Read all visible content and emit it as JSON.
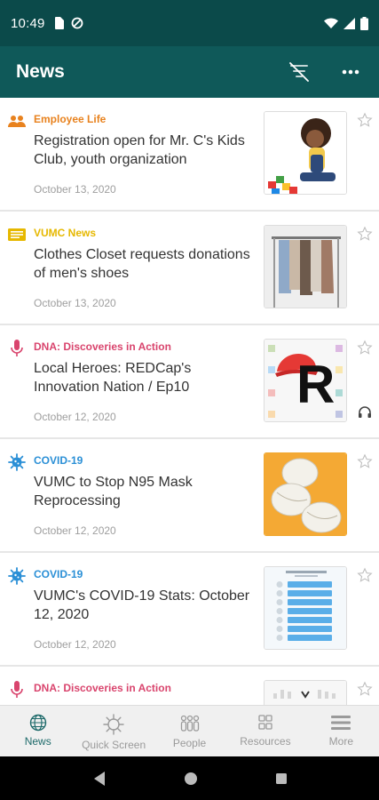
{
  "status_bar": {
    "time": "10:49"
  },
  "app_bar": {
    "title": "News"
  },
  "articles": [
    {
      "category": "Employee Life",
      "category_color": "#e8821e",
      "category_icon": "people-icon",
      "title": "Registration open for Mr. C's Kids Club, youth organization",
      "date": "October 13, 2020",
      "thumbnail": "child-playing-thumbnail"
    },
    {
      "category": "VUMC News",
      "category_color": "#e6b800",
      "category_icon": "newspaper-icon",
      "title": "Clothes Closet requests donations of men's shoes",
      "date": "October 13, 2020",
      "thumbnail": "clothes-rack-thumbnail"
    },
    {
      "category": "DNA: Discoveries in Action",
      "category_color": "#d9446d",
      "category_icon": "microphone-icon",
      "title": "Local Heroes: REDCap's Innovation Nation / Ep10",
      "date": "October 12, 2020",
      "thumbnail": "redcap-logo-thumbnail",
      "audio": true,
      "logo_letter": "R"
    },
    {
      "category": "COVID-19",
      "category_color": "#2a8fd6",
      "category_icon": "virus-icon",
      "title": "VUMC to Stop N95 Mask Reprocessing",
      "date": "October 12, 2020",
      "thumbnail": "n95-masks-thumbnail"
    },
    {
      "category": "COVID-19",
      "category_color": "#2a8fd6",
      "category_icon": "virus-icon",
      "title": "VUMC's COVID-19 Stats: October 12, 2020",
      "date": "October 12, 2020",
      "thumbnail": "stats-infographic-thumbnail"
    },
    {
      "category": "DNA: Discoveries in Action",
      "category_color": "#d9446d",
      "category_icon": "microphone-icon",
      "title": "",
      "date": "",
      "thumbnail": "audio-thumbnail"
    }
  ],
  "bottom_nav": [
    {
      "label": "News",
      "icon": "globe-icon",
      "active": true
    },
    {
      "label": "Quick Screen",
      "icon": "virus-icon",
      "active": false
    },
    {
      "label": "People",
      "icon": "people-group-icon",
      "active": false
    },
    {
      "label": "Resources",
      "icon": "grid-icon",
      "active": false
    },
    {
      "label": "More",
      "icon": "menu-icon",
      "active": false
    }
  ],
  "colors": {
    "status_bar": "#0b4a4a",
    "app_bar": "#0f5959",
    "accent": "#1f6b6b"
  }
}
